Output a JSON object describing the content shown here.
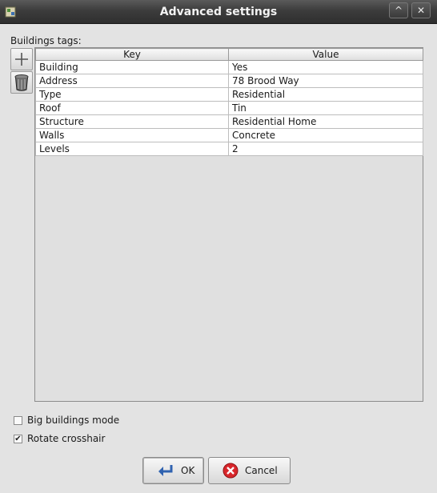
{
  "window": {
    "title": "Advanced settings",
    "maximize_glyph": "^",
    "close_glyph": "✕"
  },
  "tags_label": "Buildings tags:",
  "side_buttons": {
    "add_icon": "plus-icon",
    "delete_icon": "trash-can-icon"
  },
  "table": {
    "headers": [
      "Key",
      "Value"
    ],
    "rows": [
      {
        "key": "Building",
        "value": "Yes"
      },
      {
        "key": "Address",
        "value": "78 Brood Way"
      },
      {
        "key": "Type",
        "value": "Residential"
      },
      {
        "key": "Roof",
        "value": "Tin"
      },
      {
        "key": "Structure",
        "value": "Residential Home"
      },
      {
        "key": "Walls",
        "value": "Concrete"
      },
      {
        "key": "Levels",
        "value": "2"
      }
    ]
  },
  "options": {
    "big_buildings": {
      "label": "Big buildings mode",
      "checked": false
    },
    "rotate_crosshair": {
      "label": "Rotate crosshair",
      "checked": true,
      "mark": "✔"
    }
  },
  "buttons": {
    "ok": "OK",
    "cancel": "Cancel"
  }
}
